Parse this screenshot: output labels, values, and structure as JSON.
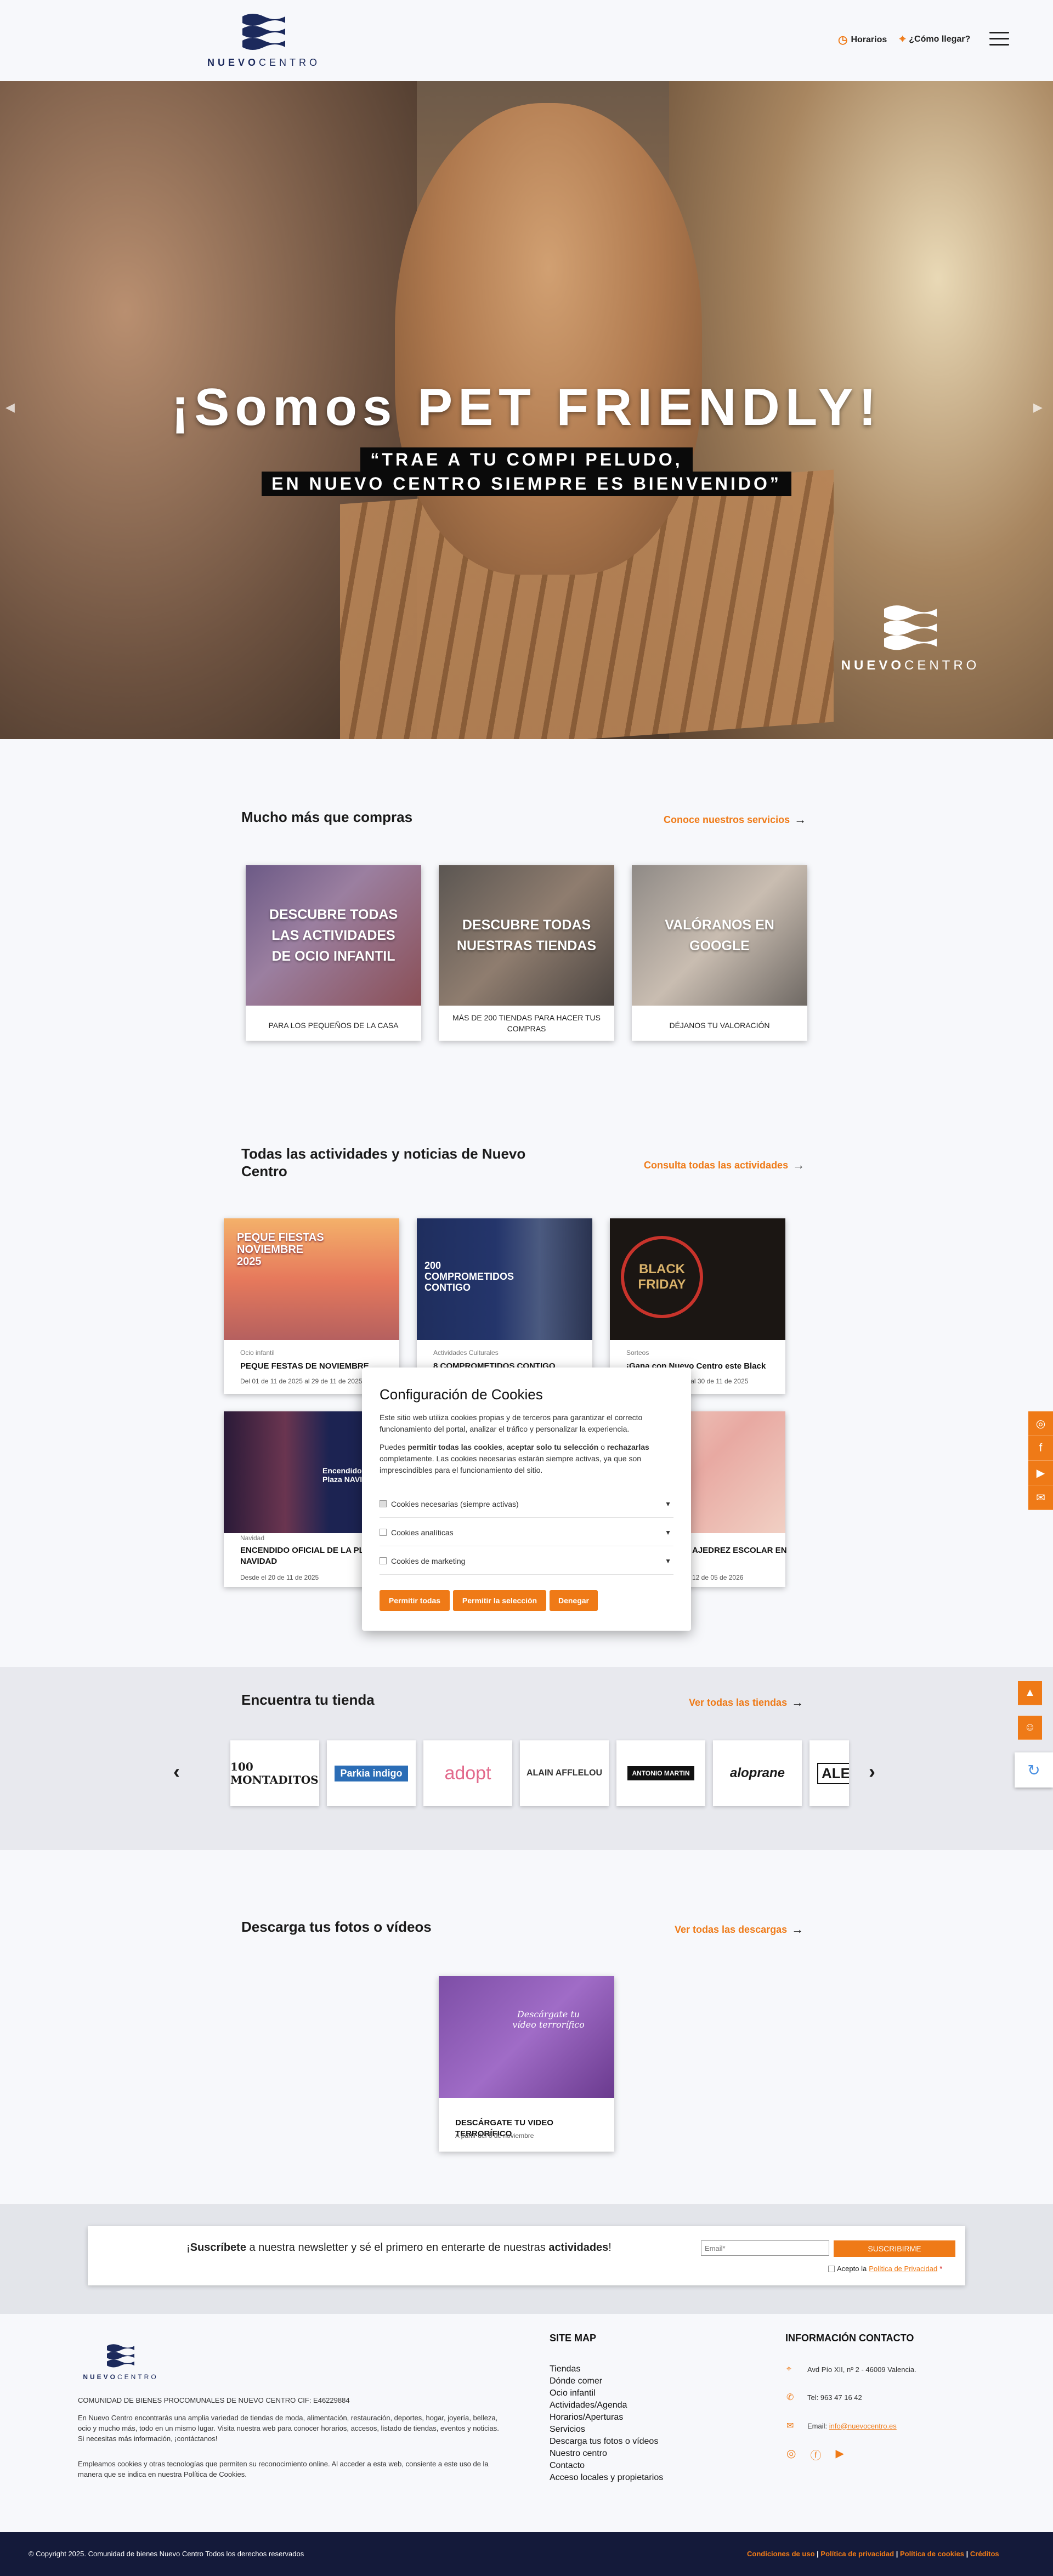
{
  "header": {
    "logo_word_bold": "NUEVO",
    "logo_word_light": "CENTRO",
    "hours": "Horarios",
    "directions": "¿Cómo llegar?"
  },
  "hero": {
    "title": "¡Somos PET FRIENDLY!",
    "line1": "“TRAE A TU COMPI PELUDO,",
    "line2": "EN NUEVO CENTRO SIEMPRE ES BIENVENIDO”",
    "logo_word_bold": "NUEVO",
    "logo_word_light": "CENTRO"
  },
  "services": {
    "title": "Mucho más que compras",
    "link": "Conoce nuestros servicios",
    "cards": [
      {
        "label": "DESCUBRE TODAS LAS ACTIVIDADES DE OCIO INFANTIL",
        "caption": "PARA LOS PEQUEÑOS DE LA CASA"
      },
      {
        "label": "DESCUBRE TODAS NUESTRAS TIENDAS",
        "caption": "MÁS DE 200 TIENDAS PARA HACER TUS COMPRAS"
      },
      {
        "label": "VALÓRANOS EN GOOGLE",
        "caption": "DÉJANOS TU VALORACIÓN"
      }
    ]
  },
  "activities": {
    "title": "Todas las actividades y noticias de Nuevo Centro",
    "link": "Consulta todas las actividades",
    "cards": [
      {
        "category": "Ocio infantil",
        "title": "PEQUE FESTAS DE NOVIEMBRE",
        "date": "Del 01 de 11 de 2025 al 29 de 11 de 2025",
        "img_text": "PEQUE FIESTAS NOVIEMBRE 2025"
      },
      {
        "category": "Actividades Culturales",
        "title": "8 COMPROMETIDOS CONTIGO",
        "date": "",
        "img_text": "200 COMPROMETIDOS CONTIGO"
      },
      {
        "category": "Sorteos",
        "title": "¡Gana con Nuevo Centro este Black Friday!",
        "date": "Del 10 de 11 de 2025 al 30 de 11 de 2025",
        "img_text": "BLACK FRIDAY"
      },
      {
        "category": "Navidad",
        "title": "ENCENDIDO OFICIAL DE LA PLAZA NAVIDAD",
        "date": "Desde el 20 de 11 de 2025",
        "img_text": "Encendido de la Plaza NAVIDAD"
      },
      {
        "category": "",
        "title": "AJEDREZ ESCOLAR EN",
        "date": "12 de 05 de 2026",
        "img_text": ""
      }
    ]
  },
  "cookie": {
    "title": "Configuración de Cookies",
    "p1": "Este sitio web utiliza cookies propias y de terceros para garantizar el correcto funcionamiento del portal, analizar el tráfico y personalizar la experiencia.",
    "p2a": "Puedes ",
    "p2b": "permitir todas las cookies",
    "p2c": ", ",
    "p2d": "aceptar solo tu selección",
    "p2e": " o ",
    "p2f": "rechazarlas",
    "p2g": " completamente. Las cookies necesarias estarán siempre activas, ya que son imprescindibles para el funcionamiento del sitio.",
    "opt1": "Cookies necesarias (siempre activas)",
    "opt2": "Cookies analíticas",
    "opt3": "Cookies de marketing",
    "btn_all": "Permitir todas",
    "btn_sel": "Permitir la selección",
    "btn_deny": "Denegar"
  },
  "stores": {
    "title": "Encuentra tu tienda",
    "link": "Ver todas las tiendas",
    "logos": [
      "100 MONTADITOS",
      "Parkia indigo",
      "adopt",
      "ALAIN AFFLELOU",
      "ANTONIO MARTIN",
      "aloprane",
      "ALE"
    ]
  },
  "downloads": {
    "title": "Descarga tus fotos o vídeos",
    "link": "Ver todas las descargas",
    "card_title": "DESCÁRGATE TU VIDEO TERRORÍFICO",
    "card_date": "A partir del 6 de noviembre",
    "img_text": "Descárgate tu vídeo terrorífico"
  },
  "newsletter": {
    "t1": "¡",
    "t2": "Suscríbete",
    "t3": " a nuestra newsletter y sé el primero en enterarte de nuestras ",
    "t4": "actividades",
    "t5": "!",
    "email_placeholder": "Email*",
    "button": "SUSCRIBIRME",
    "accept": "Acepto la ",
    "privacy": "Política de Privacidad",
    "req": " *"
  },
  "footer": {
    "logo_word_bold": "NUEVO",
    "logo_word_light": "CENTRO",
    "cif": "COMUNIDAD DE BIENES PROCOMUNALES DE NUEVO CENTRO CIF: E46229884",
    "desc1": "En Nuevo Centro encontrarás una amplia variedad de tiendas de moda, alimentación, restauración, deportes, hogar, joyería, belleza, ocio y mucho más, todo en un mismo lugar. Visita nuestra web para conocer horarios, accesos, listado de tiendas, eventos y noticias. Si necesitas más información, ¡contáctanos!",
    "desc2": "Empleamos cookies y otras tecnologías que permiten su reconocimiento online. Al acceder a esta web, consiente a este uso de la manera que se indica en nuestra Política de Cookies.",
    "sitemap_title": "SITE MAP",
    "sitemap": [
      "Tiendas",
      "Dónde comer",
      "Ocio infantil",
      "Actividades/Agenda",
      "Horarios/Aperturas",
      "Servicios",
      "Descarga tus fotos o vídeos",
      "Nuestro centro",
      "Contacto",
      "Acceso locales y propietarios"
    ],
    "contact_title": "INFORMACIÓN CONTACTO",
    "address": "Avd Pío XII, nº 2 - 46009 Valencia.",
    "phone": "Tel: 963 47 16 42",
    "email_label": "Email: ",
    "email": "info@nuevocentro.es",
    "copyright": "© Copyright 2025. Comunidad de bienes Nuevo Centro Todos los derechos reservados",
    "legal": [
      "Condiciones de uso",
      "Política de privacidad",
      "Política de cookies",
      "Créditos"
    ]
  },
  "colors": {
    "accent": "#ef7a17",
    "navy": "#1c2a5c",
    "footer_bar": "#141a3a"
  }
}
